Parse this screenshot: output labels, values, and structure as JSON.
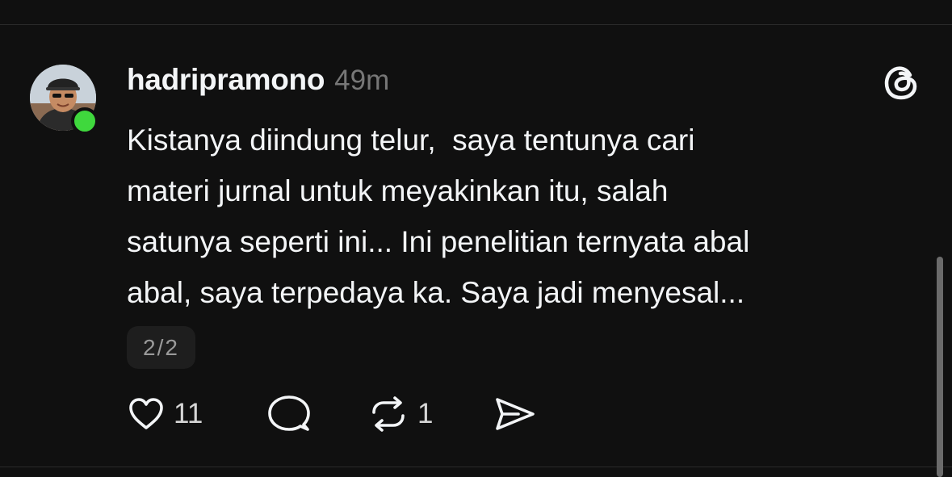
{
  "post": {
    "username": "hadripramono",
    "timestamp": "49m",
    "text_lines": [
      "Kistanya diindung telur,  saya tentunya cari",
      "materi jurnal untuk meyakinkan itu, salah",
      "satunya seperti ini... Ini penelitian ternyata abal",
      "abal, saya terpedaya ka. Saya jadi menyesal..."
    ],
    "page_indicator": "2/2",
    "online_status_color": "#3fd83d"
  },
  "actions": {
    "like_icon": "heart-icon",
    "like_count": "11",
    "reply_icon": "comment-bubble-icon",
    "repost_icon": "repost-icon",
    "repost_count": "1",
    "share_icon": "send-icon"
  },
  "app": {
    "logo_icon": "threads-logo-icon"
  }
}
